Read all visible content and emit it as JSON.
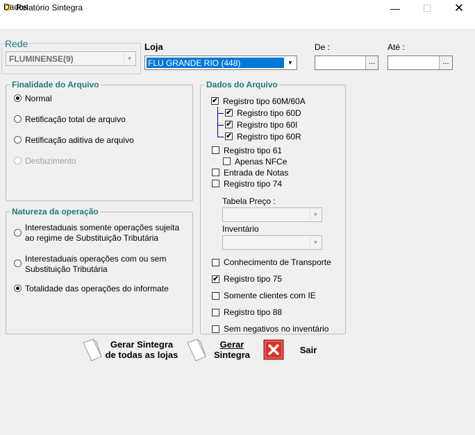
{
  "window": {
    "title": "Relatório Sintegra"
  },
  "menu": {
    "dados": "Dados"
  },
  "rede": {
    "label": "Rede",
    "value": "FLUMINENSE(9)"
  },
  "loja": {
    "label": "Loja",
    "value": "FLU GRANDE RIO (448)"
  },
  "de": {
    "label": "De :",
    "value": "",
    "button": "..."
  },
  "ate": {
    "label": "Até :",
    "value": "",
    "button": "..."
  },
  "finalidade": {
    "title": "Finalidade do Arquivo",
    "options": [
      "Normal",
      "Retificação total de arquivo",
      "Retificação aditiva de arquivo",
      "Desfazimento"
    ],
    "selected": 0
  },
  "natureza": {
    "title": "Natureza da operação",
    "opt1_line1": "Interestaduais somente operações sujeita",
    "opt1_line2": "ao regime de Substituição Tributária",
    "opt2_line1": "Interestaduais operações com ou sem",
    "opt2_line2": "Substituição Tributária",
    "opt3": "Totalidade das operações do informate",
    "selected": 2
  },
  "dados_arquivo": {
    "title": "Dados do Arquivo",
    "reg60": {
      "label": "Registro tipo 60M/60A",
      "checked": true
    },
    "reg60d": {
      "label": "Registro tipo 60D",
      "checked": true
    },
    "reg60i": {
      "label": "Registro tipo 60I",
      "checked": true
    },
    "reg60r": {
      "label": "Registro tipo 60R",
      "checked": true
    },
    "reg61": {
      "label": "Registro tipo 61",
      "checked": false
    },
    "nfce": {
      "label": "Apenas NFCe",
      "checked": false
    },
    "entrada": {
      "label": "Entrada de Notas",
      "checked": false
    },
    "reg74": {
      "label": "Registro tipo 74",
      "checked": false
    },
    "tabela_preco": {
      "label": "Tabela Preço :",
      "value": ""
    },
    "inventario": {
      "label": "Inventário",
      "value": ""
    },
    "conhecimento": {
      "label": "Conhecimento de Transporte",
      "checked": false
    },
    "reg75": {
      "label": "Registro tipo 75",
      "checked": true
    },
    "somente_ie": {
      "label": "Somente clientes com IE",
      "checked": false
    },
    "reg88": {
      "label": "Registro tipo 88",
      "checked": false
    },
    "sem_negativos": {
      "label": "Sem negativos no inventário",
      "checked": false
    }
  },
  "buttons": {
    "gerar_todas_line1": "Gerar Sintegra",
    "gerar_todas_line2": "de todas as lojas",
    "gerar_line1": "Gerar",
    "gerar_line2": "Sintegra",
    "sair": "Sair"
  },
  "colors": {
    "group_title": "#1f7a7a",
    "selection": "#0078d7",
    "close_red": "#d9302a"
  }
}
